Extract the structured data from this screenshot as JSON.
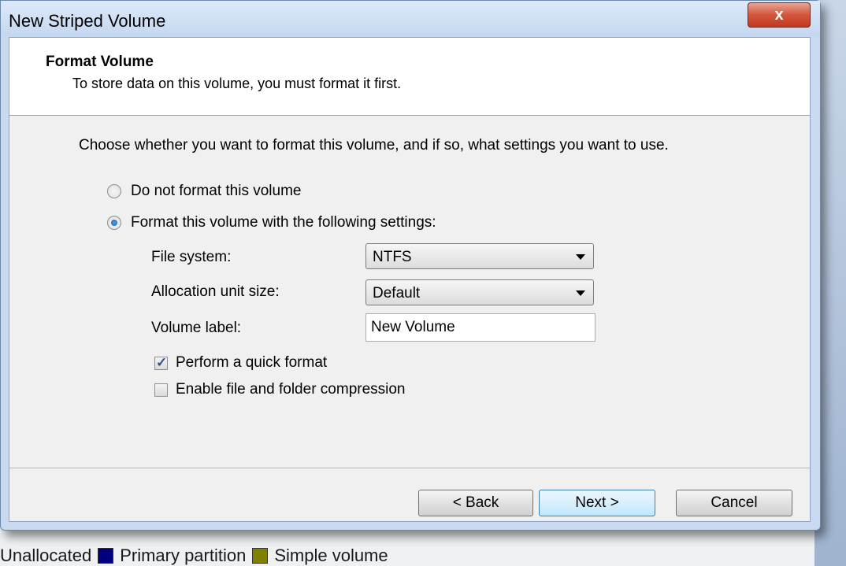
{
  "dialog": {
    "title": "New Striped Volume",
    "close_glyph": "x"
  },
  "header": {
    "title": "Format Volume",
    "subtitle": "To store data on this volume, you must format it first."
  },
  "intro": "Choose whether you want to format this volume, and if so, what settings you want to use.",
  "options": {
    "no_format": {
      "label": "Do not format this volume",
      "selected": false
    },
    "format": {
      "label": "Format this volume with the following settings:",
      "selected": true
    }
  },
  "settings": {
    "file_system": {
      "label": "File system:",
      "value": "NTFS"
    },
    "allocation": {
      "label": "Allocation unit size:",
      "value": "Default"
    },
    "volume_label": {
      "label": "Volume label:",
      "value": "New Volume"
    },
    "quick_format": {
      "label": "Perform a quick format",
      "checked": true
    },
    "compression": {
      "label": "Enable file and folder compression",
      "checked": false
    }
  },
  "buttons": {
    "back": "< Back",
    "next": "Next >",
    "cancel": "Cancel"
  },
  "legend": [
    {
      "label": "Unallocated",
      "color": "#1a1a1a"
    },
    {
      "label": "Primary partition",
      "color": "#00007f"
    },
    {
      "label": "Simple volume",
      "color": "#7f7f00"
    }
  ]
}
